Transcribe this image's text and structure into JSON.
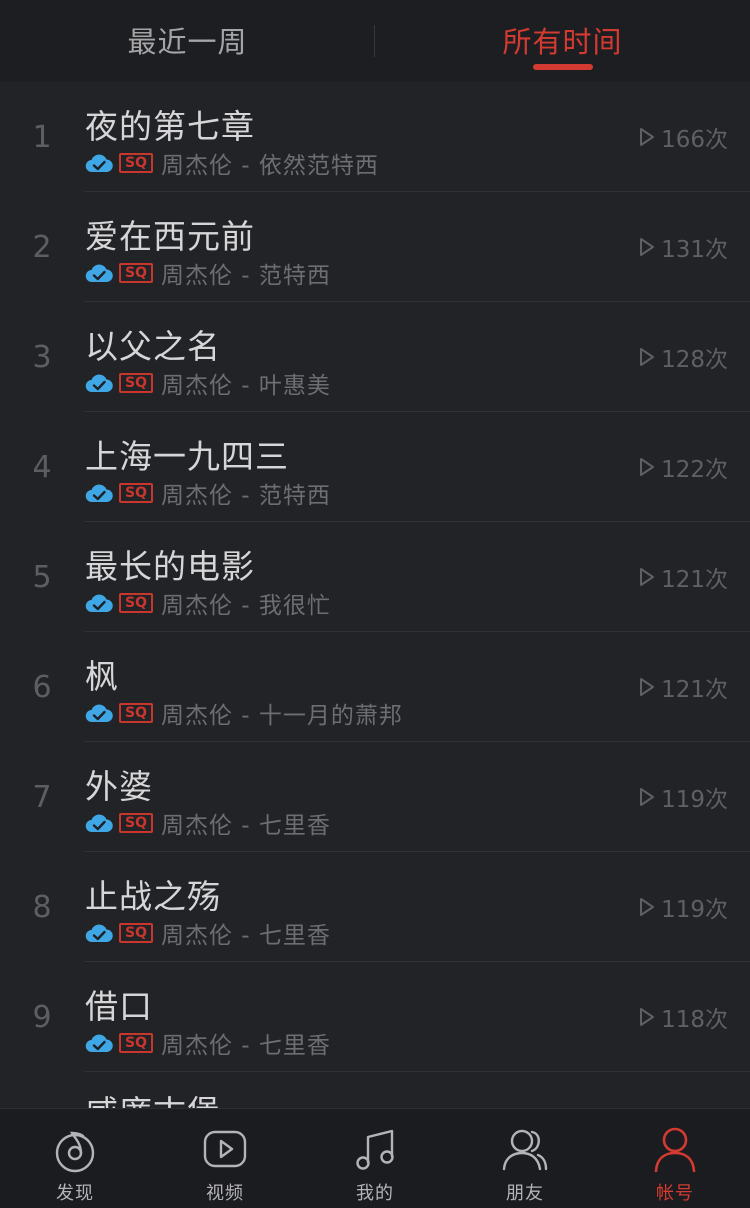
{
  "tabs": [
    {
      "label": "最近一周",
      "active": false
    },
    {
      "label": "所有时间",
      "active": true
    }
  ],
  "songs": [
    {
      "rank": "1",
      "title": "夜的第七章",
      "subtitle": "周杰伦 - 依然范特西",
      "plays": "166次"
    },
    {
      "rank": "2",
      "title": "爱在西元前",
      "subtitle": "周杰伦 - 范特西",
      "plays": "131次"
    },
    {
      "rank": "3",
      "title": "以父之名",
      "subtitle": "周杰伦 - 叶惠美",
      "plays": "128次"
    },
    {
      "rank": "4",
      "title": "上海一九四三",
      "subtitle": "周杰伦 - 范特西",
      "plays": "122次"
    },
    {
      "rank": "5",
      "title": "最长的电影",
      "subtitle": "周杰伦 - 我很忙",
      "plays": "121次"
    },
    {
      "rank": "6",
      "title": "枫",
      "subtitle": "周杰伦 - 十一月的萧邦",
      "plays": "121次"
    },
    {
      "rank": "7",
      "title": "外婆",
      "subtitle": "周杰伦 - 七里香",
      "plays": "119次"
    },
    {
      "rank": "8",
      "title": "止战之殇",
      "subtitle": "周杰伦 - 七里香",
      "plays": "119次"
    },
    {
      "rank": "9",
      "title": "借口",
      "subtitle": "周杰伦 - 七里香",
      "plays": "118次"
    }
  ],
  "partial_song": {
    "title": "威廉古堡"
  },
  "badges": {
    "quality": "SQ"
  },
  "icons": {
    "downloaded": "cloud-check-icon",
    "plays": "play-triangle-icon"
  },
  "nav": [
    {
      "label": "发现",
      "icon": "discover-icon",
      "active": false
    },
    {
      "label": "视频",
      "icon": "video-icon",
      "active": false
    },
    {
      "label": "我的",
      "icon": "music-note-icon",
      "active": false
    },
    {
      "label": "朋友",
      "icon": "friends-icon",
      "active": false
    },
    {
      "label": "帐号",
      "icon": "account-icon",
      "active": true
    }
  ],
  "colors": {
    "accent": "#d33a31",
    "cloud": "#3fa7e6",
    "background": "#222326"
  }
}
